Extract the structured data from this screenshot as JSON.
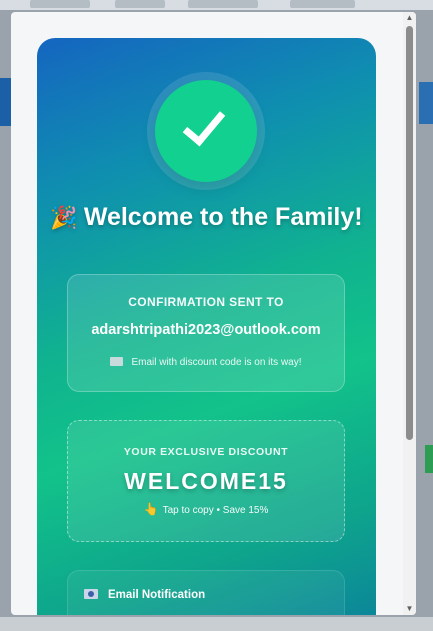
{
  "success_card": {
    "title": "Welcome to the Family!",
    "party_emoji": "🎉",
    "confirmation": {
      "label": "CONFIRMATION SENT TO",
      "email": "adarshtripathi2023@outlook.com",
      "note": "Email with discount code is on its way!"
    },
    "discount": {
      "label": "YOUR EXCLUSIVE DISCOUNT",
      "code": "WELCOME15",
      "hint": "Tap to copy • Save 15%",
      "hand_emoji": "👆"
    },
    "notification": {
      "label": "Email Notification"
    }
  },
  "scrollbar": {
    "up_arrow": "▲",
    "down_arrow": "▼"
  },
  "colors": {
    "gradient_start": "#1565c0",
    "gradient_mid": "#12c28a",
    "check_circle": "#12d08f"
  }
}
